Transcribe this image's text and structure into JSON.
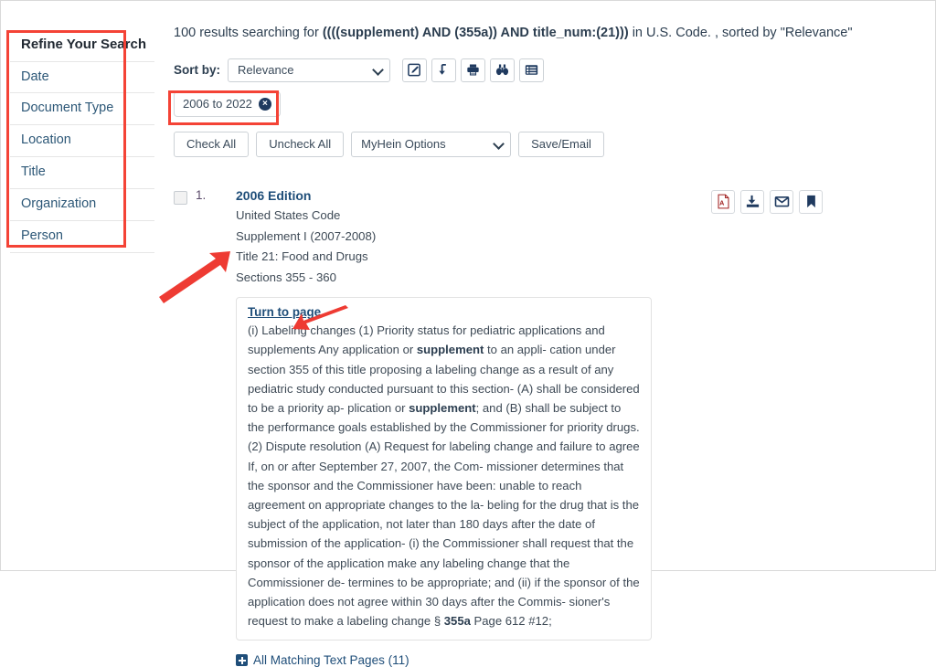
{
  "sidebar": {
    "heading": "Refine Your Search",
    "items": [
      {
        "label": "Date",
        "name": "date"
      },
      {
        "label": "Document Type",
        "name": "document-type"
      },
      {
        "label": "Location",
        "name": "location"
      },
      {
        "label": "Title",
        "name": "title"
      },
      {
        "label": "Organization",
        "name": "organization"
      },
      {
        "label": "Person",
        "name": "person"
      }
    ]
  },
  "results_header": {
    "prefix": "100 results searching for ",
    "query": "((((supplement) AND (355a)) AND title_num:(21)))",
    "middle": " in U.S. Code. , sorted by ",
    "sort_value": "\"Relevance\""
  },
  "toolbar": {
    "sort_label": "Sort by:",
    "sort_selected": "Relevance",
    "icons": [
      {
        "name": "edit-search-icon",
        "title": "Edit Search"
      },
      {
        "name": "download-icon",
        "title": "Download"
      },
      {
        "name": "print-icon",
        "title": "Print"
      },
      {
        "name": "binoculars-icon",
        "title": "Search Within"
      },
      {
        "name": "list-view-icon",
        "title": "List View"
      }
    ]
  },
  "filter_chip": {
    "label": "2006 to 2022",
    "remove_icon": "×"
  },
  "actions": {
    "check_all": "Check All",
    "uncheck_all": "Uncheck All",
    "myhein_options": "MyHein Options",
    "save_email": "Save/Email"
  },
  "result": {
    "index": "1.",
    "title": "2006 Edition",
    "lines": [
      "United States Code",
      "Supplement I (2007-2008)",
      "Title 21: Food and Drugs",
      "Sections 355 - 360"
    ],
    "icons": [
      {
        "name": "pdf-icon",
        "title": "PDF"
      },
      {
        "name": "download-icon",
        "title": "Download"
      },
      {
        "name": "email-icon",
        "title": "Email"
      },
      {
        "name": "bookmark-icon",
        "title": "Bookmark"
      }
    ],
    "snippet": {
      "turn_to_page": "Turn to page",
      "part1": "(i) Labeling changes (1) Priority status for pediatric applications and supplements Any application or ",
      "bold1": "supplement",
      "part2": " to an appli- cation under section 355 of this title proposing a labeling change as a result of any pediatric study conducted pursuant to this section- (A) shall be considered to be a priority ap- plication or ",
      "bold2": "supplement",
      "part3": "; and (B) shall be subject to the performance goals established by the Commissioner for priority drugs. (2) Dispute resolution (A) Request for labeling change and failure to agree If, on or after September 27, 2007, the Com- missioner determines that the sponsor and the Commissioner have been: unable to reach agreement on appropriate changes to the la- beling for the drug that is the subject of the application, not later than 180 days after the date of submission of the application- (i) the Commissioner shall request that the sponsor of the application make any labeling change that the Commissioner de- termines to be appropriate; and (ii) if the sponsor of the application does not agree within 30 days after the Commis- sioner's request to make a labeling change § ",
      "bold3": "355a",
      "part4": " Page 612 #12;"
    },
    "matching_pages": "All Matching Text Pages (11)"
  },
  "annotations": {
    "box_color": "#f44336",
    "arrow_color": "#ee3b33"
  }
}
